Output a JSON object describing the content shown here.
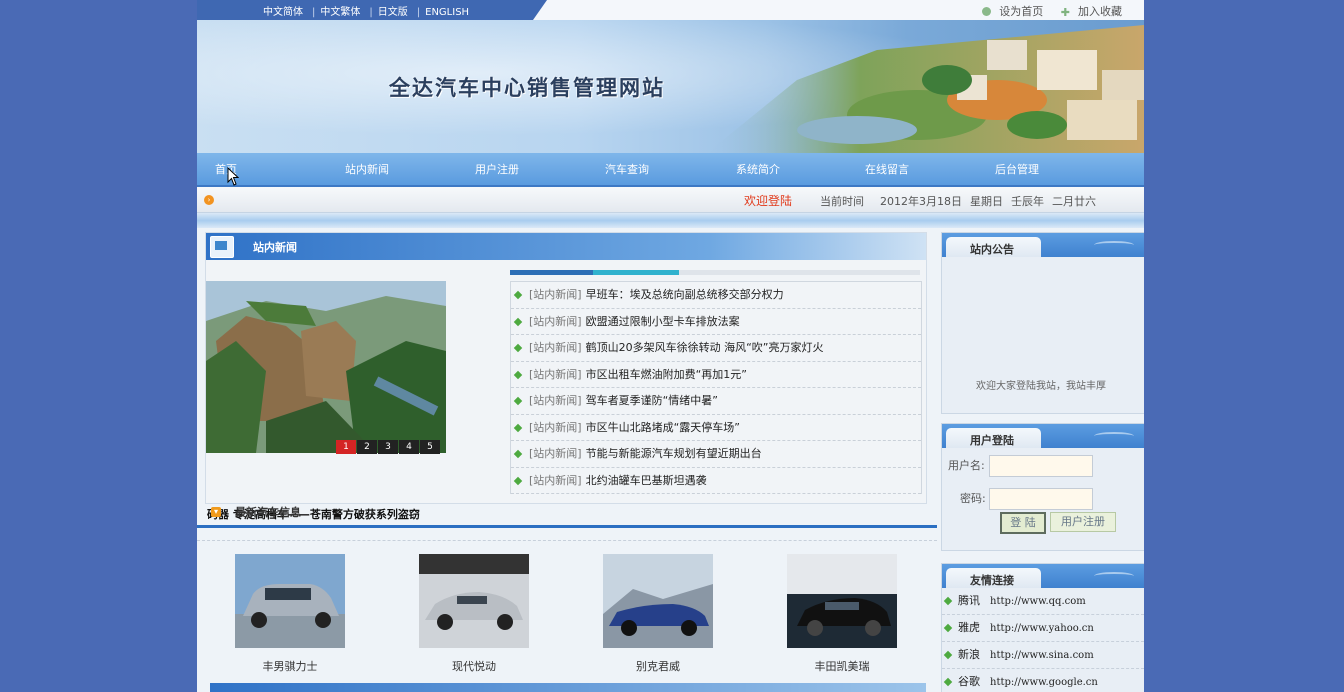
{
  "languages": [
    "中文简体",
    "中文繁体",
    "日文版",
    "ENGLISH"
  ],
  "top_links": {
    "homepage": "设为首页",
    "favorite": "加入收藏"
  },
  "site_title": "全达汽车中心销售管理网站",
  "nav": [
    "首页",
    "站内新闻",
    "用户注册",
    "汽车查询",
    "系统简介",
    "在线留言",
    "后台管理"
  ],
  "infobar": {
    "welcome": "欢迎登陆",
    "time_label": "当前时间",
    "date": "2012年3月18日",
    "weekday": "星期日",
    "year": "壬辰年",
    "lunar": "二月廿六"
  },
  "news": {
    "title": "站内新闻",
    "slideshow": {
      "pages": [
        "1",
        "2",
        "3",
        "4",
        "5"
      ],
      "active": 1,
      "caption": "码器 专淀高档车——苍南警方破获系列盗窃"
    },
    "items": [
      {
        "category": "[站内新闻]",
        "title": "早班车：埃及总统向副总统移交部分权力"
      },
      {
        "category": "[站内新闻]",
        "title": "欧盟通过限制小型卡车排放法案"
      },
      {
        "category": "[站内新闻]",
        "title": "鹤顶山20多架风车徐徐转动 海风“吹”亮万家灯火"
      },
      {
        "category": "[站内新闻]",
        "title": "市区出租车燃油附加费“再加1元”"
      },
      {
        "category": "[站内新闻]",
        "title": "驾车者夏季谨防“情绪中暑”"
      },
      {
        "category": "[站内新闻]",
        "title": "市区牛山北路堵成“露天停车场”"
      },
      {
        "category": "[站内新闻]",
        "title": "节能与新能源汽车规划有望近期出台"
      },
      {
        "category": "[站内新闻]",
        "title": "北约油罐车巴基斯坦遇袭"
      }
    ]
  },
  "latest_cars": {
    "title": "最新汽车信息",
    "cars": [
      {
        "name": "丰男骐力士"
      },
      {
        "name": "现代悦动"
      },
      {
        "name": "别克君威"
      },
      {
        "name": "丰田凯美瑞"
      }
    ]
  },
  "notice": {
    "title": "站内公告",
    "text": "欢迎大家登陆我站，我站丰厚"
  },
  "login": {
    "title": "用户登陆",
    "username_label": "用户名:",
    "password_label": "密码:",
    "login_button": "登 陆",
    "register_button": "用户注册"
  },
  "friend_links": {
    "title": "友情连接",
    "items": [
      {
        "name": "腾讯",
        "url": "http://www.qq.com"
      },
      {
        "name": "雅虎",
        "url": "http://www.yahoo.cn"
      },
      {
        "name": "新浪",
        "url": "http://www.sina.com"
      },
      {
        "name": "谷歌",
        "url": "http://www.google.cn"
      }
    ]
  },
  "colors": {
    "page_bg": "#4a6ab5",
    "nav": "#5a9bdf",
    "welcome": "#e13b1c",
    "accent": "#2b6fc2"
  }
}
